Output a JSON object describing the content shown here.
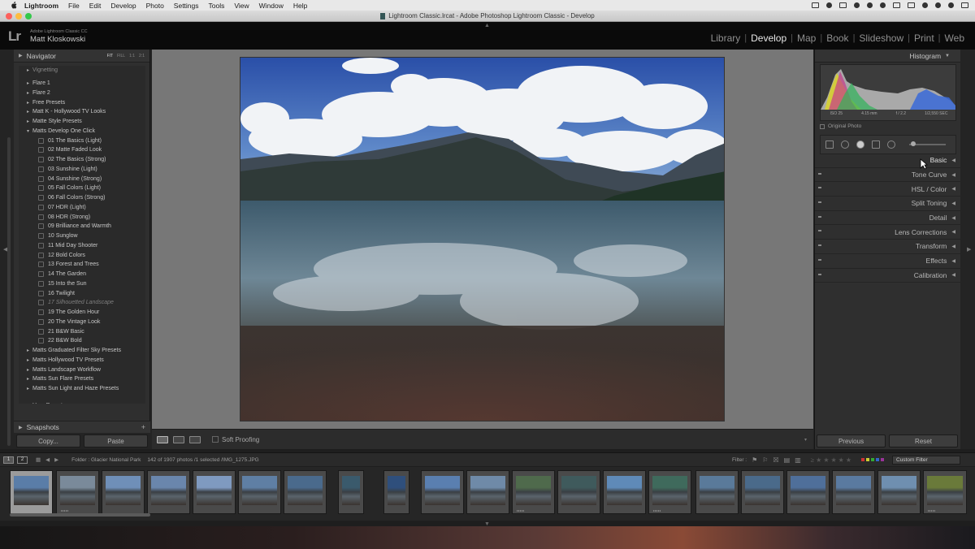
{
  "menubar": {
    "app": "Lightroom",
    "items": [
      "File",
      "Edit",
      "Develop",
      "Photo",
      "Settings",
      "Tools",
      "View",
      "Window",
      "Help"
    ]
  },
  "window": {
    "title": "Lightroom Classic.lrcat - Adobe Photoshop Lightroom Classic - Develop"
  },
  "identity": {
    "product": "Adobe Lightroom Classic CC",
    "user": "Matt Kloskowski"
  },
  "modules": [
    "Library",
    "Develop",
    "Map",
    "Book",
    "Slideshow",
    "Print",
    "Web"
  ],
  "left_panel": {
    "navigator": "Navigator",
    "nav_options": [
      "FIT",
      "FILL",
      "1:1",
      "2:1"
    ],
    "presets_top": "Vignetting",
    "folders_before": [
      "Flare 1",
      "Flare 2",
      "Free Presets",
      "Matt K - Hollywood TV Looks",
      "Matte Style Presets"
    ],
    "open_folder": "Matts Develop One Click",
    "children": [
      "01 The Basics (Light)",
      "02 Matte Faded Look",
      "02 The Basics (Strong)",
      "03 Sunshine (Light)",
      "04 Sunshine (Strong)",
      "05 Fall Colors (Light)",
      "06 Fall Colors (Strong)",
      "07 HDR (Light)",
      "08 HDR (Strong)",
      "09 Brilliance and Warmth",
      "10 Sunglow",
      "11 Mid Day Shooter",
      "12 Bold Colors",
      "13 Forest and Trees",
      "14 The Garden",
      "15 Into the Sun",
      "16 Twilight",
      "17 Silhouetted Landscape",
      "19 The Golden Hour",
      "20 The Vintage Look",
      "21 B&W Basic",
      "22 B&W Bold"
    ],
    "dim_child_index": 17,
    "folders_after": [
      "Matts Graduated Filter Sky Presets",
      "Matts Hollywood TV Presets",
      "Matts Landscape Workflow",
      "Matts Sun Flare Presets",
      "Matts Sun Light and Haze Presets"
    ],
    "user_presets": "User Presets",
    "snapshots": "Snapshots",
    "copy": "Copy...",
    "paste": "Paste"
  },
  "toolbar": {
    "soft_proofing": "Soft Proofing"
  },
  "right_panel": {
    "histogram": "Histogram",
    "info": [
      "ISO 25",
      "4.15 mm",
      "f / 2.2",
      "1/2,550 SEC"
    ],
    "original_photo": "Original Photo",
    "panels": [
      "Basic",
      "Tone Curve",
      "HSL / Color",
      "Split Toning",
      "Detail",
      "Lens Corrections",
      "Transform",
      "Effects",
      "Calibration"
    ],
    "previous": "Previous",
    "reset": "Reset"
  },
  "filmstrip_bar": {
    "page1": "1",
    "page2": "2",
    "folder": "Folder : Glacier National Park",
    "count": "142 of 1907 photos /1 selected /IMG_1275.JPG",
    "filter": "Filter :",
    "custom_filter": "Custom Filter"
  },
  "colors": {
    "accent": "#e6e6e6",
    "panel": "#2f2f2f",
    "background": "#242424"
  }
}
